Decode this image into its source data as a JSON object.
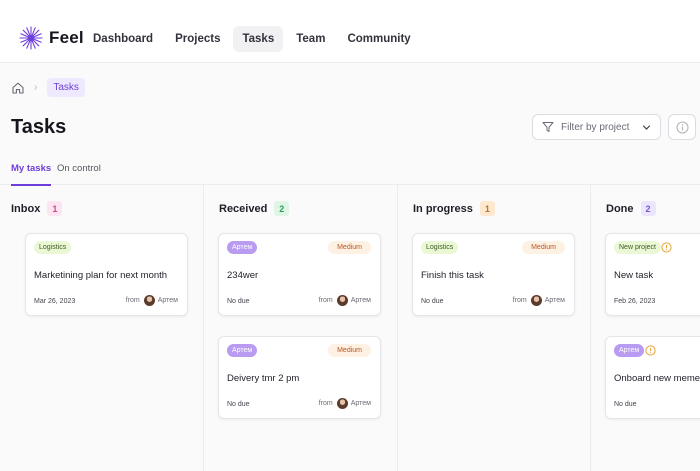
{
  "app": {
    "name": "Feel"
  },
  "nav": {
    "items": [
      "Dashboard",
      "Projects",
      "Tasks",
      "Team",
      "Community"
    ],
    "active": "Tasks"
  },
  "breadcrumb": {
    "current": "Tasks"
  },
  "page": {
    "title": "Tasks"
  },
  "filter": {
    "placeholder": "Filter by project"
  },
  "tabs": [
    "My tasks",
    "On control"
  ],
  "columns": [
    {
      "title": "Inbox",
      "count": "1",
      "count_bg": "#fde4f1",
      "count_color": "#d0468b",
      "cards": [
        {
          "tag": "Logistics",
          "title": "Marketining plan for next month",
          "date": "Mar 26, 2023",
          "from": "from",
          "user": "Артем"
        }
      ]
    },
    {
      "title": "Received",
      "count": "2",
      "count_bg": "#dff5e6",
      "count_color": "#2f9e58",
      "cards": [
        {
          "tag": "Артем",
          "priority": "Medium",
          "title": "234wer",
          "date": "No due",
          "from": "from",
          "user": "Артем"
        },
        {
          "tag": "Артем",
          "priority": "Medium",
          "title": "Deivery tmr 2 pm",
          "date": "No due",
          "from": "from",
          "user": "Артем"
        }
      ]
    },
    {
      "title": "In progress",
      "count": "1",
      "count_bg": "#fde9cf",
      "count_color": "#c4721c",
      "cards": [
        {
          "tag": "Logistics",
          "priority": "Medium",
          "title": "Finish this task",
          "date": "No due",
          "from": "from",
          "user": "Артем"
        }
      ]
    },
    {
      "title": "Done",
      "count": "2",
      "count_bg": "#ece6fd",
      "count_color": "#7b55d9",
      "cards": [
        {
          "tag": "New project",
          "title": "New task",
          "date": "Feb 26, 2023"
        },
        {
          "tag": "Артем",
          "title": "Onboard new memeber",
          "date": "No due"
        }
      ]
    }
  ],
  "colors": {
    "accent": "#6d3fd8",
    "tag_logistics_bg": "#eaf8d6",
    "tag_user_bg": "#b99cf1",
    "priority_bg": "#fdf1e4",
    "priority_text": "#c0561f",
    "warning": "#e6a53a"
  },
  "icons": [
    "logo-burst-icon",
    "home-icon",
    "chevron-right-icon",
    "filter-icon",
    "chevron-down-icon",
    "info-icon",
    "warning-icon"
  ]
}
